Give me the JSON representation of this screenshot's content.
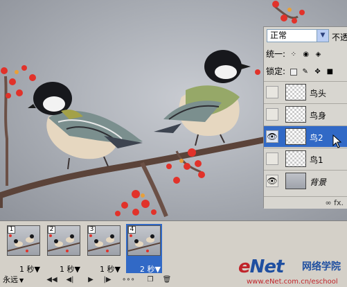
{
  "layers_panel": {
    "blend_mode": "正常",
    "opacity_label": "不透",
    "unify_label": "统一:",
    "lock_label": "锁定:",
    "layers": [
      {
        "name": "鸟头",
        "visible": false,
        "selected": false,
        "thumb": "transparent"
      },
      {
        "name": "鸟身",
        "visible": false,
        "selected": false,
        "thumb": "transparent"
      },
      {
        "name": "鸟2",
        "visible": true,
        "selected": true,
        "thumb": "transparent"
      },
      {
        "name": "鸟1",
        "visible": false,
        "selected": false,
        "thumb": "transparent"
      },
      {
        "name": "背景",
        "visible": true,
        "selected": false,
        "thumb": "photo"
      }
    ],
    "footer": "∞ fx."
  },
  "animation": {
    "frames": [
      {
        "number": "1",
        "delay": "1 秒▼",
        "selected": false
      },
      {
        "number": "2",
        "delay": "1 秒▼",
        "selected": false
      },
      {
        "number": "3",
        "delay": "1 秒▼",
        "selected": false
      },
      {
        "number": "4",
        "delay": "2 秒▼",
        "selected": true
      }
    ],
    "loop": "永远",
    "controls": [
      "first-frame",
      "previous-frame",
      "play",
      "next-frame",
      "tween",
      "duplicate-frame",
      "delete-frame"
    ]
  },
  "watermark": {
    "logo_e": "e",
    "logo_net": "Net",
    "cn": "网络学院",
    "url": "www.eNet.com.cn/eschool"
  },
  "colors": {
    "selection": "#3169c6",
    "panel": "#d8d6d0",
    "berry": "#e1322a"
  }
}
